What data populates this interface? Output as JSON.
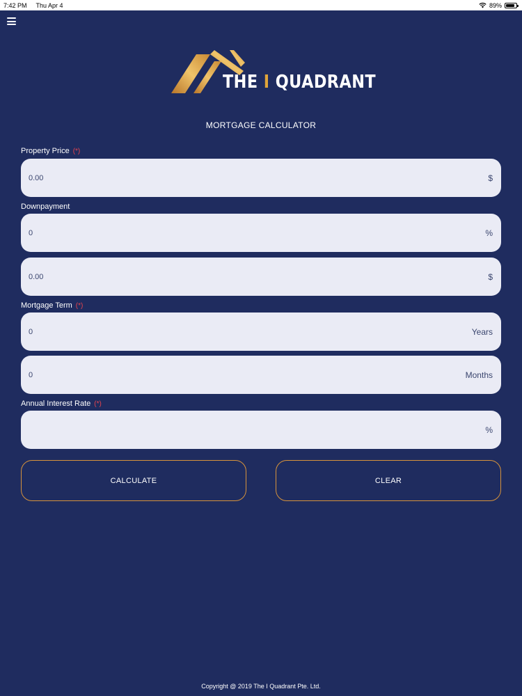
{
  "status_bar": {
    "time": "7:42 PM",
    "date": "Thu Apr 4",
    "battery": "89%",
    "battery_level": 0.89
  },
  "logo": {
    "word1": "THE",
    "separator": "I",
    "word2": "QUADRANT",
    "gold_color": "#e0a53a"
  },
  "page_title": "MORTGAGE CALCULATOR",
  "form": {
    "property_price": {
      "label": "Property Price",
      "required_mark": "(*)",
      "value": "0.00",
      "unit": "$"
    },
    "downpayment": {
      "label": "Downpayment",
      "percent_value": "0",
      "percent_unit": "%",
      "amount_value": "0.00",
      "amount_unit": "$"
    },
    "mortgage_term": {
      "label": "Mortgage Term",
      "required_mark": "(*)",
      "years_value": "0",
      "years_unit": "Years",
      "months_value": "0",
      "months_unit": "Months"
    },
    "interest_rate": {
      "label": "Annual Interest Rate",
      "required_mark": "(*)",
      "value": "",
      "unit": "%"
    }
  },
  "buttons": {
    "calculate": "CALCULATE",
    "clear": "CLEAR"
  },
  "footer": "Copyright @ 2019 The I Quadrant Pte. Ltd.",
  "colors": {
    "background": "#1f2c5f",
    "field": "#eaebf5",
    "accent": "#d7933b",
    "required": "#e7444d"
  }
}
